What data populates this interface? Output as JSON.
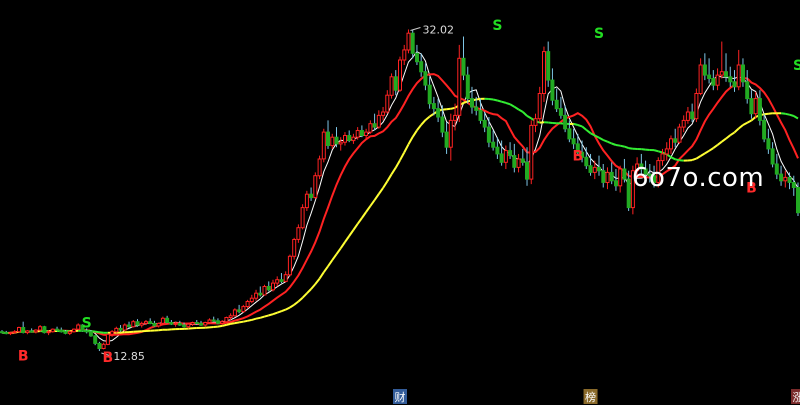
{
  "chart_data": {
    "type": "candlestick",
    "ylim": [
      11.6,
      33.3
    ],
    "annotations": {
      "high_label": "32.02",
      "low_label": "12.85"
    },
    "signals": [
      {
        "text": "B",
        "x": 5,
        "price": 12.3,
        "color": "#ff2a2a"
      },
      {
        "text": "S",
        "x": 20,
        "price": 14.25,
        "color": "#22dd22"
      },
      {
        "text": "B",
        "x": 25,
        "price": 12.2,
        "color": "#ff2a2a"
      },
      {
        "text": "S",
        "x": 117,
        "price": 32.0,
        "color": "#22dd22"
      },
      {
        "text": "S",
        "x": 141,
        "price": 31.5,
        "color": "#22dd22"
      },
      {
        "text": "B",
        "x": 136,
        "price": 24.2,
        "color": "#ff2a2a"
      },
      {
        "text": "B",
        "x": 177,
        "price": 22.3,
        "color": "#ff2a2a"
      },
      {
        "text": "S",
        "x": 207,
        "price": 29.6,
        "color": "#22dd22"
      }
    ],
    "bottom_markers": [
      {
        "text": "财",
        "x": 94,
        "bg": "#335c99"
      },
      {
        "text": "榜",
        "x": 139,
        "bg": "#8a6a2a"
      },
      {
        "text": "涨",
        "x": 188,
        "bg": "#7a2a2a"
      }
    ],
    "ma_colors": {
      "short": "#ffffff",
      "mid": "#ff2222",
      "long_up": "#ffff33",
      "long_down": "#33ee33"
    },
    "candle_colors": {
      "up": "#ff2222",
      "down": "#22aa22",
      "up_fill": "#000000"
    },
    "n_candles": 229,
    "candles_sample_note": "",
    "candles": [
      [
        14.0,
        14.1,
        13.9,
        13.95
      ],
      [
        13.95,
        14.05,
        13.85,
        13.9
      ],
      [
        13.9,
        14.0,
        13.8,
        13.95
      ],
      [
        13.95,
        14.1,
        13.9,
        14.0
      ],
      [
        14.0,
        14.3,
        13.95,
        14.25
      ],
      [
        14.25,
        14.6,
        13.9,
        13.95
      ],
      [
        13.95,
        14.1,
        13.85,
        14.05
      ],
      [
        14.05,
        14.2,
        13.95,
        14.0
      ],
      [
        14.0,
        14.15,
        13.9,
        14.1
      ],
      [
        14.1,
        14.4,
        14.0,
        14.3
      ],
      [
        14.3,
        14.35,
        13.9,
        13.95
      ],
      [
        13.95,
        14.1,
        13.8,
        14.0
      ],
      [
        14.0,
        14.2,
        13.95,
        14.15
      ],
      [
        14.15,
        14.3,
        14.05,
        14.1
      ],
      [
        14.1,
        14.25,
        13.95,
        14.0
      ],
      [
        14.0,
        14.1,
        13.85,
        13.9
      ],
      [
        13.9,
        14.05,
        13.8,
        14.0
      ],
      [
        14.0,
        14.2,
        13.95,
        14.15
      ],
      [
        14.15,
        14.5,
        14.1,
        14.4
      ],
      [
        14.4,
        14.45,
        14.0,
        14.05
      ],
      [
        14.05,
        14.2,
        13.9,
        14.0
      ],
      [
        14.0,
        14.1,
        13.7,
        13.75
      ],
      [
        13.75,
        13.8,
        13.2,
        13.3
      ],
      [
        13.3,
        13.4,
        12.85,
        13.0
      ],
      [
        13.0,
        13.35,
        12.95,
        13.25
      ],
      [
        13.25,
        13.9,
        13.2,
        13.85
      ],
      [
        13.85,
        14.1,
        13.7,
        14.0
      ],
      [
        14.0,
        14.3,
        13.95,
        14.2
      ],
      [
        14.2,
        14.4,
        14.0,
        14.1
      ],
      [
        14.1,
        14.5,
        14.05,
        14.4
      ],
      [
        14.4,
        14.6,
        14.2,
        14.3
      ],
      [
        14.3,
        14.7,
        14.25,
        14.6
      ],
      [
        14.6,
        14.75,
        14.3,
        14.4
      ],
      [
        14.4,
        14.6,
        14.25,
        14.5
      ],
      [
        14.5,
        14.7,
        14.4,
        14.6
      ],
      [
        14.6,
        14.8,
        14.45,
        14.5
      ],
      [
        14.5,
        14.65,
        14.3,
        14.35
      ],
      [
        14.35,
        14.55,
        14.25,
        14.5
      ],
      [
        14.5,
        14.9,
        14.45,
        14.8
      ],
      [
        14.8,
        14.95,
        14.5,
        14.55
      ],
      [
        14.55,
        14.7,
        14.4,
        14.45
      ],
      [
        14.45,
        14.6,
        14.3,
        14.5
      ],
      [
        14.5,
        14.65,
        14.35,
        14.4
      ],
      [
        14.4,
        14.55,
        14.25,
        14.3
      ],
      [
        14.3,
        14.5,
        14.2,
        14.45
      ],
      [
        14.45,
        14.6,
        14.35,
        14.55
      ],
      [
        14.55,
        14.7,
        14.4,
        14.5
      ],
      [
        14.5,
        14.65,
        14.35,
        14.4
      ],
      [
        14.4,
        14.6,
        14.3,
        14.55
      ],
      [
        14.55,
        14.8,
        14.5,
        14.7
      ],
      [
        14.7,
        14.9,
        14.6,
        14.65
      ],
      [
        14.65,
        14.8,
        14.45,
        14.5
      ],
      [
        14.5,
        14.7,
        14.4,
        14.6
      ],
      [
        14.6,
        14.9,
        14.55,
        14.85
      ],
      [
        14.85,
        15.1,
        14.7,
        14.95
      ],
      [
        14.95,
        15.4,
        14.9,
        15.3
      ],
      [
        15.3,
        15.6,
        15.1,
        15.2
      ],
      [
        15.2,
        15.6,
        15.15,
        15.5
      ],
      [
        15.5,
        15.9,
        15.4,
        15.8
      ],
      [
        15.8,
        16.2,
        15.7,
        16.0
      ],
      [
        16.0,
        16.5,
        15.85,
        16.3
      ],
      [
        16.3,
        16.7,
        16.1,
        16.2
      ],
      [
        16.2,
        16.8,
        16.15,
        16.7
      ],
      [
        16.7,
        17.0,
        16.4,
        16.5
      ],
      [
        16.5,
        17.1,
        16.4,
        16.9
      ],
      [
        16.9,
        17.3,
        16.7,
        17.1
      ],
      [
        17.1,
        17.5,
        16.9,
        17.0
      ],
      [
        17.0,
        17.6,
        16.95,
        17.4
      ],
      [
        17.4,
        18.6,
        17.3,
        18.5
      ],
      [
        18.5,
        19.6,
        18.3,
        19.5
      ],
      [
        19.5,
        20.4,
        19.3,
        20.2
      ],
      [
        20.2,
        21.6,
        20.1,
        21.4
      ],
      [
        21.4,
        22.4,
        21.2,
        22.2
      ],
      [
        22.2,
        22.6,
        21.8,
        22.0
      ],
      [
        22.0,
        23.5,
        21.9,
        23.3
      ],
      [
        23.3,
        24.5,
        23.1,
        24.3
      ],
      [
        24.3,
        26.1,
        24.1,
        25.9
      ],
      [
        25.9,
        26.6,
        24.9,
        25.1
      ],
      [
        25.1,
        25.8,
        24.9,
        25.6
      ],
      [
        25.6,
        26.2,
        25.0,
        25.2
      ],
      [
        25.2,
        25.6,
        24.8,
        25.3
      ],
      [
        25.3,
        25.9,
        25.1,
        25.7
      ],
      [
        25.7,
        26.0,
        25.3,
        25.4
      ],
      [
        25.4,
        25.8,
        25.2,
        25.6
      ],
      [
        25.6,
        26.2,
        25.45,
        26.0
      ],
      [
        26.0,
        26.3,
        25.6,
        25.7
      ],
      [
        25.7,
        26.1,
        25.5,
        25.9
      ],
      [
        25.9,
        26.6,
        25.8,
        26.4
      ],
      [
        26.4,
        27.0,
        26.0,
        26.2
      ],
      [
        26.2,
        27.2,
        26.1,
        26.9
      ],
      [
        26.9,
        27.4,
        26.6,
        27.1
      ],
      [
        27.1,
        28.4,
        27.0,
        28.1
      ],
      [
        28.1,
        29.4,
        27.9,
        29.2
      ],
      [
        29.2,
        29.6,
        28.1,
        28.4
      ],
      [
        28.4,
        30.4,
        28.3,
        30.2
      ],
      [
        30.2,
        31.1,
        29.9,
        30.8
      ],
      [
        30.8,
        32.02,
        30.6,
        31.8
      ],
      [
        31.8,
        32.0,
        30.3,
        30.6
      ],
      [
        30.6,
        31.1,
        29.9,
        30.1
      ],
      [
        30.1,
        30.6,
        29.2,
        29.5
      ],
      [
        29.5,
        30.0,
        28.4,
        28.7
      ],
      [
        28.7,
        29.2,
        27.3,
        27.6
      ],
      [
        27.6,
        28.0,
        26.9,
        27.3
      ],
      [
        27.3,
        27.9,
        26.5,
        26.8
      ],
      [
        26.8,
        27.5,
        25.6,
        25.9
      ],
      [
        25.9,
        26.5,
        24.6,
        25.0
      ],
      [
        25.0,
        27.0,
        24.2,
        26.6
      ],
      [
        26.6,
        27.6,
        26.0,
        26.9
      ],
      [
        26.9,
        31.1,
        26.5,
        30.3
      ],
      [
        30.3,
        31.6,
        29.0,
        29.3
      ],
      [
        29.3,
        29.8,
        27.6,
        27.9
      ],
      [
        27.9,
        28.6,
        27.0,
        27.4
      ],
      [
        27.4,
        28.0,
        26.9,
        27.2
      ],
      [
        27.2,
        27.9,
        26.4,
        26.6
      ],
      [
        26.6,
        27.1,
        25.9,
        26.2
      ],
      [
        26.2,
        26.8,
        25.0,
        25.3
      ],
      [
        25.3,
        26.0,
        24.8,
        25.0
      ],
      [
        25.0,
        25.6,
        24.3,
        24.6
      ],
      [
        24.6,
        25.4,
        23.9,
        24.1
      ],
      [
        24.1,
        25.1,
        23.7,
        24.8
      ],
      [
        24.8,
        25.3,
        24.3,
        24.5
      ],
      [
        24.5,
        25.2,
        23.5,
        23.8
      ],
      [
        23.8,
        24.6,
        23.5,
        24.3
      ],
      [
        24.3,
        24.9,
        23.9,
        24.1
      ],
      [
        24.1,
        25.0,
        22.7,
        23.1
      ],
      [
        23.1,
        26.6,
        22.8,
        26.3
      ],
      [
        26.3,
        27.0,
        25.9,
        26.7
      ],
      [
        26.7,
        28.6,
        26.5,
        28.2
      ],
      [
        28.2,
        31.0,
        27.7,
        30.7
      ],
      [
        30.7,
        31.3,
        28.6,
        29.0
      ],
      [
        29.0,
        29.7,
        27.5,
        27.8
      ],
      [
        27.8,
        28.5,
        27.1,
        27.3
      ],
      [
        27.3,
        28.0,
        26.7,
        26.9
      ],
      [
        26.9,
        27.5,
        25.9,
        26.1
      ],
      [
        26.1,
        26.6,
        25.3,
        25.5
      ],
      [
        25.5,
        26.1,
        24.9,
        25.2
      ],
      [
        25.2,
        25.8,
        24.5,
        24.7
      ],
      [
        24.7,
        25.4,
        24.1,
        24.4
      ],
      [
        24.4,
        25.0,
        23.7,
        23.9
      ],
      [
        23.9,
        24.6,
        23.3,
        23.5
      ],
      [
        23.5,
        24.2,
        23.1,
        23.8
      ],
      [
        23.8,
        24.5,
        23.3,
        23.6
      ],
      [
        23.6,
        24.0,
        22.6,
        22.9
      ],
      [
        22.9,
        23.8,
        22.5,
        23.5
      ],
      [
        23.5,
        24.1,
        22.8,
        23.0
      ],
      [
        23.0,
        23.7,
        22.4,
        22.7
      ],
      [
        22.7,
        23.9,
        22.3,
        23.7
      ],
      [
        23.7,
        24.3,
        22.9,
        23.1
      ],
      [
        23.1,
        23.6,
        21.2,
        21.4
      ],
      [
        21.4,
        23.9,
        21.0,
        23.6
      ],
      [
        23.6,
        24.4,
        23.3,
        24.0
      ],
      [
        24.0,
        24.6,
        23.4,
        23.7
      ],
      [
        23.7,
        24.2,
        23.0,
        23.4
      ],
      [
        23.4,
        24.0,
        22.9,
        23.3
      ],
      [
        23.3,
        23.9,
        22.6,
        22.9
      ],
      [
        22.9,
        24.4,
        22.6,
        24.2
      ],
      [
        24.2,
        24.9,
        23.9,
        24.6
      ],
      [
        24.6,
        25.3,
        24.2,
        24.9
      ],
      [
        24.9,
        25.7,
        24.6,
        25.5
      ],
      [
        25.5,
        26.1,
        25.0,
        25.3
      ],
      [
        25.3,
        26.4,
        25.2,
        26.2
      ],
      [
        26.2,
        26.9,
        25.9,
        26.6
      ],
      [
        26.6,
        27.4,
        26.4,
        27.1
      ],
      [
        27.1,
        27.6,
        26.5,
        26.7
      ],
      [
        26.7,
        28.5,
        26.5,
        28.2
      ],
      [
        28.2,
        30.3,
        28.1,
        29.9
      ],
      [
        29.9,
        30.6,
        29.0,
        29.3
      ],
      [
        29.3,
        30.3,
        28.8,
        29.1
      ],
      [
        29.1,
        29.6,
        28.4,
        28.7
      ],
      [
        28.7,
        29.7,
        28.4,
        29.3
      ],
      [
        29.3,
        31.3,
        29.1,
        29.5
      ],
      [
        29.5,
        30.6,
        28.9,
        29.2
      ],
      [
        29.2,
        29.8,
        28.6,
        28.9
      ],
      [
        28.9,
        29.6,
        28.3,
        28.6
      ],
      [
        28.6,
        30.8,
        28.4,
        29.9
      ],
      [
        29.9,
        30.3,
        28.6,
        28.9
      ],
      [
        28.9,
        29.6,
        27.6,
        27.9
      ],
      [
        27.9,
        28.4,
        26.7,
        27.0
      ],
      [
        27.0,
        28.3,
        26.7,
        27.9
      ],
      [
        27.9,
        28.4,
        26.3,
        26.6
      ],
      [
        26.6,
        27.0,
        25.3,
        25.5
      ],
      [
        25.5,
        26.1,
        24.6,
        24.9
      ],
      [
        24.9,
        25.3,
        23.8,
        24.0
      ],
      [
        24.0,
        24.6,
        23.1,
        23.4
      ],
      [
        23.4,
        23.9,
        22.7,
        23.0
      ],
      [
        23.0,
        23.6,
        22.6,
        23.2
      ],
      [
        23.2,
        23.5,
        22.5,
        22.9
      ],
      [
        22.9,
        23.3,
        22.1,
        22.6
      ],
      [
        22.6,
        22.9,
        20.9,
        21.1
      ]
    ]
  }
}
